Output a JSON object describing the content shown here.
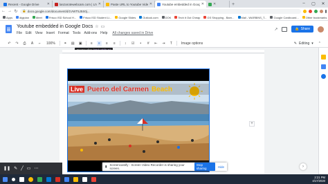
{
  "browser": {
    "tabs": [
      {
        "title": "Recent - Google Drive",
        "color": "#1a73e8",
        "active": false
      },
      {
        "title": "lanzarotewebcam.com | LIVE",
        "color": "#c5221f",
        "active": false
      },
      {
        "title": "Paste URL to Youtube Video HERE",
        "color": "#fbbc04",
        "active": false
      },
      {
        "title": "Youtube embedded in Google Docs",
        "color": "#4285f4",
        "active": true
      },
      {
        "title": "",
        "color": "#34a853",
        "active": false
      }
    ],
    "url": "docs.google.com/document/d/1VWT5J5S0j...",
    "bookmarks": [
      {
        "label": "Apps",
        "color": "#5f6368"
      },
      {
        "label": "digiplan",
        "color": "#4285f4"
      },
      {
        "label": "Meet",
        "color": "#34a853"
      },
      {
        "label": "Frisco ISD School H...",
        "color": "#1a73e8"
      },
      {
        "label": "Frisco ISD Student Li...",
        "color": "#1a73e8"
      },
      {
        "label": "Google Slides",
        "color": "#fbbc04"
      },
      {
        "label": "Outlook.com",
        "color": "#0078d4"
      },
      {
        "label": "DOK",
        "color": "#5f6368"
      },
      {
        "label": "Tech it Out Cheap",
        "color": "#ea4335"
      },
      {
        "label": "GS Shopping - Barn...",
        "color": "#ea4335"
      },
      {
        "label": "Mail - WARBINS_T...",
        "color": "#0078d4"
      },
      {
        "label": "Google Cardboard...",
        "color": "#5f6368"
      }
    ],
    "other_bookmarks": "Other bookmarks"
  },
  "docs": {
    "title": "Youtube embedded in Google Docs",
    "menus": [
      "File",
      "Edit",
      "View",
      "Insert",
      "Format",
      "Tools",
      "Add-ons",
      "Help"
    ],
    "saved_status": "All changes saved in Drive",
    "share_label": "Share",
    "zoom": "100%",
    "image_options": "Image options",
    "mode": "Editing",
    "tooltip": "Center align",
    "tooltip_shortcut": "(Ctrl+Shift+E)"
  },
  "video": {
    "live_label": "Live",
    "place": "Puerto del Carmen",
    "beach": "Beach"
  },
  "screencastify": {
    "message": "Screencastify - Screen Video Recorder is sharing your screen.",
    "stop_label": "Stop sharing",
    "hide_label": "Hide"
  },
  "taskbar": {
    "time": "2:21 PM",
    "date": "4/17/2020"
  }
}
